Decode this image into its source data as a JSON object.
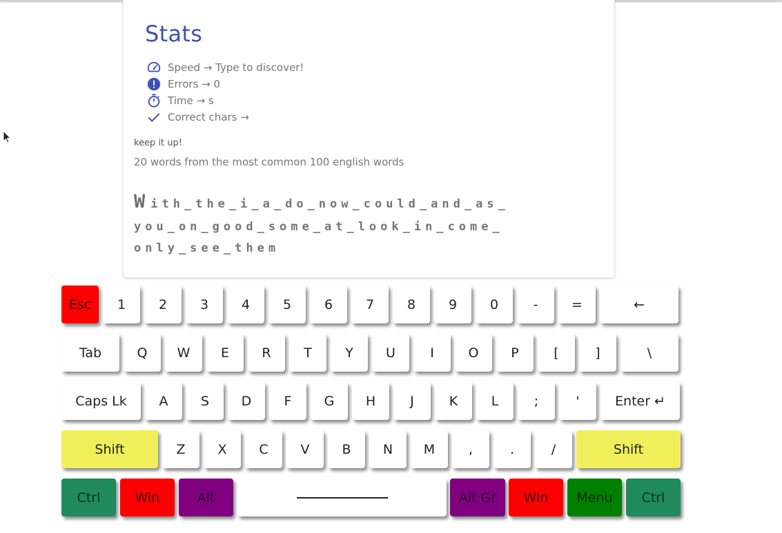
{
  "stats": {
    "title": "Stats",
    "items": [
      {
        "icon": "speedometer-icon",
        "label": "Speed → Type to discover!"
      },
      {
        "icon": "error-icon",
        "label": "Errors → 0"
      },
      {
        "icon": "timer-icon",
        "label": "Time → s"
      },
      {
        "icon": "checkmark-icon",
        "label": "Correct chars →"
      }
    ]
  },
  "encouragement": "keep it up!",
  "word_set": "20 words from the most common 100 english words",
  "typing": {
    "current_char": "W",
    "line1_rest": "ith_the_i_a_do_now_could_and_as_",
    "line2": "you_on_good_some_at_look_in_come_",
    "line3": "only_see_them"
  },
  "colors": {
    "accent": "#3f51b5",
    "red": "#ff0000",
    "yellow": "#f0ef5b",
    "green": "#1f8a5b",
    "darkgreen": "#008000",
    "purple": "#800080"
  },
  "keyboard": {
    "rows": [
      [
        {
          "label": "Esc",
          "color": "red"
        },
        {
          "label": "1"
        },
        {
          "label": "2"
        },
        {
          "label": "3"
        },
        {
          "label": "4"
        },
        {
          "label": "5"
        },
        {
          "label": "6"
        },
        {
          "label": "7"
        },
        {
          "label": "8"
        },
        {
          "label": "9"
        },
        {
          "label": "0"
        },
        {
          "label": "-"
        },
        {
          "label": "="
        },
        {
          "label": "←"
        }
      ],
      [
        {
          "label": "Tab"
        },
        {
          "label": "Q"
        },
        {
          "label": "W"
        },
        {
          "label": "E"
        },
        {
          "label": "R"
        },
        {
          "label": "T"
        },
        {
          "label": "Y"
        },
        {
          "label": "U"
        },
        {
          "label": "I"
        },
        {
          "label": "O"
        },
        {
          "label": "P"
        },
        {
          "label": "["
        },
        {
          "label": "]"
        },
        {
          "label": "\\"
        }
      ],
      [
        {
          "label": "Caps Lk"
        },
        {
          "label": "A"
        },
        {
          "label": "S"
        },
        {
          "label": "D"
        },
        {
          "label": "F"
        },
        {
          "label": "G"
        },
        {
          "label": "H"
        },
        {
          "label": "J"
        },
        {
          "label": "K"
        },
        {
          "label": "L"
        },
        {
          "label": ";"
        },
        {
          "label": "'"
        },
        {
          "label": "Enter ↵"
        }
      ],
      [
        {
          "label": "Shift",
          "color": "yellow"
        },
        {
          "label": "Z"
        },
        {
          "label": "X"
        },
        {
          "label": "C"
        },
        {
          "label": "V"
        },
        {
          "label": "B"
        },
        {
          "label": "N"
        },
        {
          "label": "M"
        },
        {
          "label": ","
        },
        {
          "label": "."
        },
        {
          "label": "/"
        },
        {
          "label": "Shift",
          "color": "yellow"
        }
      ],
      [
        {
          "label": "Ctrl",
          "color": "green"
        },
        {
          "label": "Win",
          "color": "red"
        },
        {
          "label": "Alt",
          "color": "purple"
        },
        {
          "label": "",
          "space": true
        },
        {
          "label": "Alt Gr",
          "color": "purple"
        },
        {
          "label": "Win",
          "color": "red"
        },
        {
          "label": "Menu",
          "color": "darkgreen"
        },
        {
          "label": "Ctrl",
          "color": "green"
        }
      ]
    ]
  }
}
